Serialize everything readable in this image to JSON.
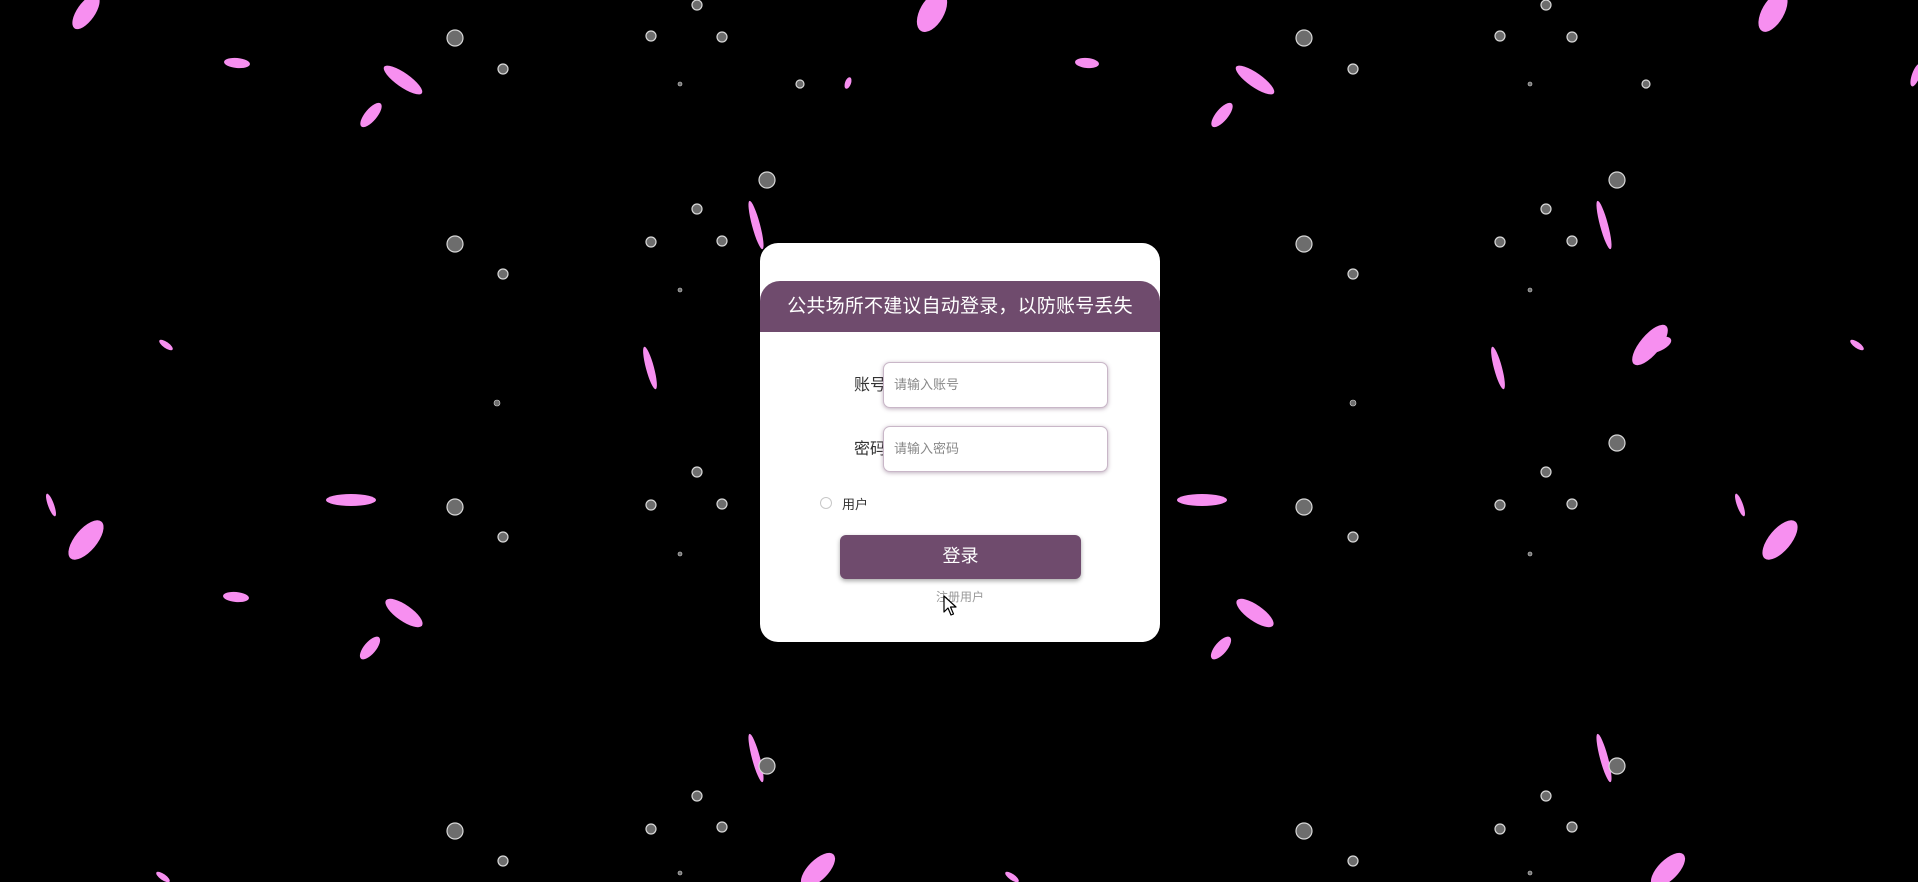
{
  "login": {
    "header_text": "公共场所不建议自动登录，以防账号丢失",
    "account_label": "账号",
    "account_placeholder": "请输入账号",
    "account_value": "",
    "password_label": "密码",
    "password_placeholder": "请输入密码",
    "password_value": "",
    "role_option_label": "用户",
    "role_option_selected": false,
    "login_button_label": "登录",
    "register_link_label": "注册用户"
  },
  "theme": {
    "background": "#000000",
    "accent": "#6f4b6d",
    "petal": "#f78ff0",
    "card": "#ffffff"
  },
  "icons": {
    "background_decoration": [
      "petal-icon",
      "water-droplet-icon"
    ],
    "pointer": "mouse-cursor-icon"
  }
}
